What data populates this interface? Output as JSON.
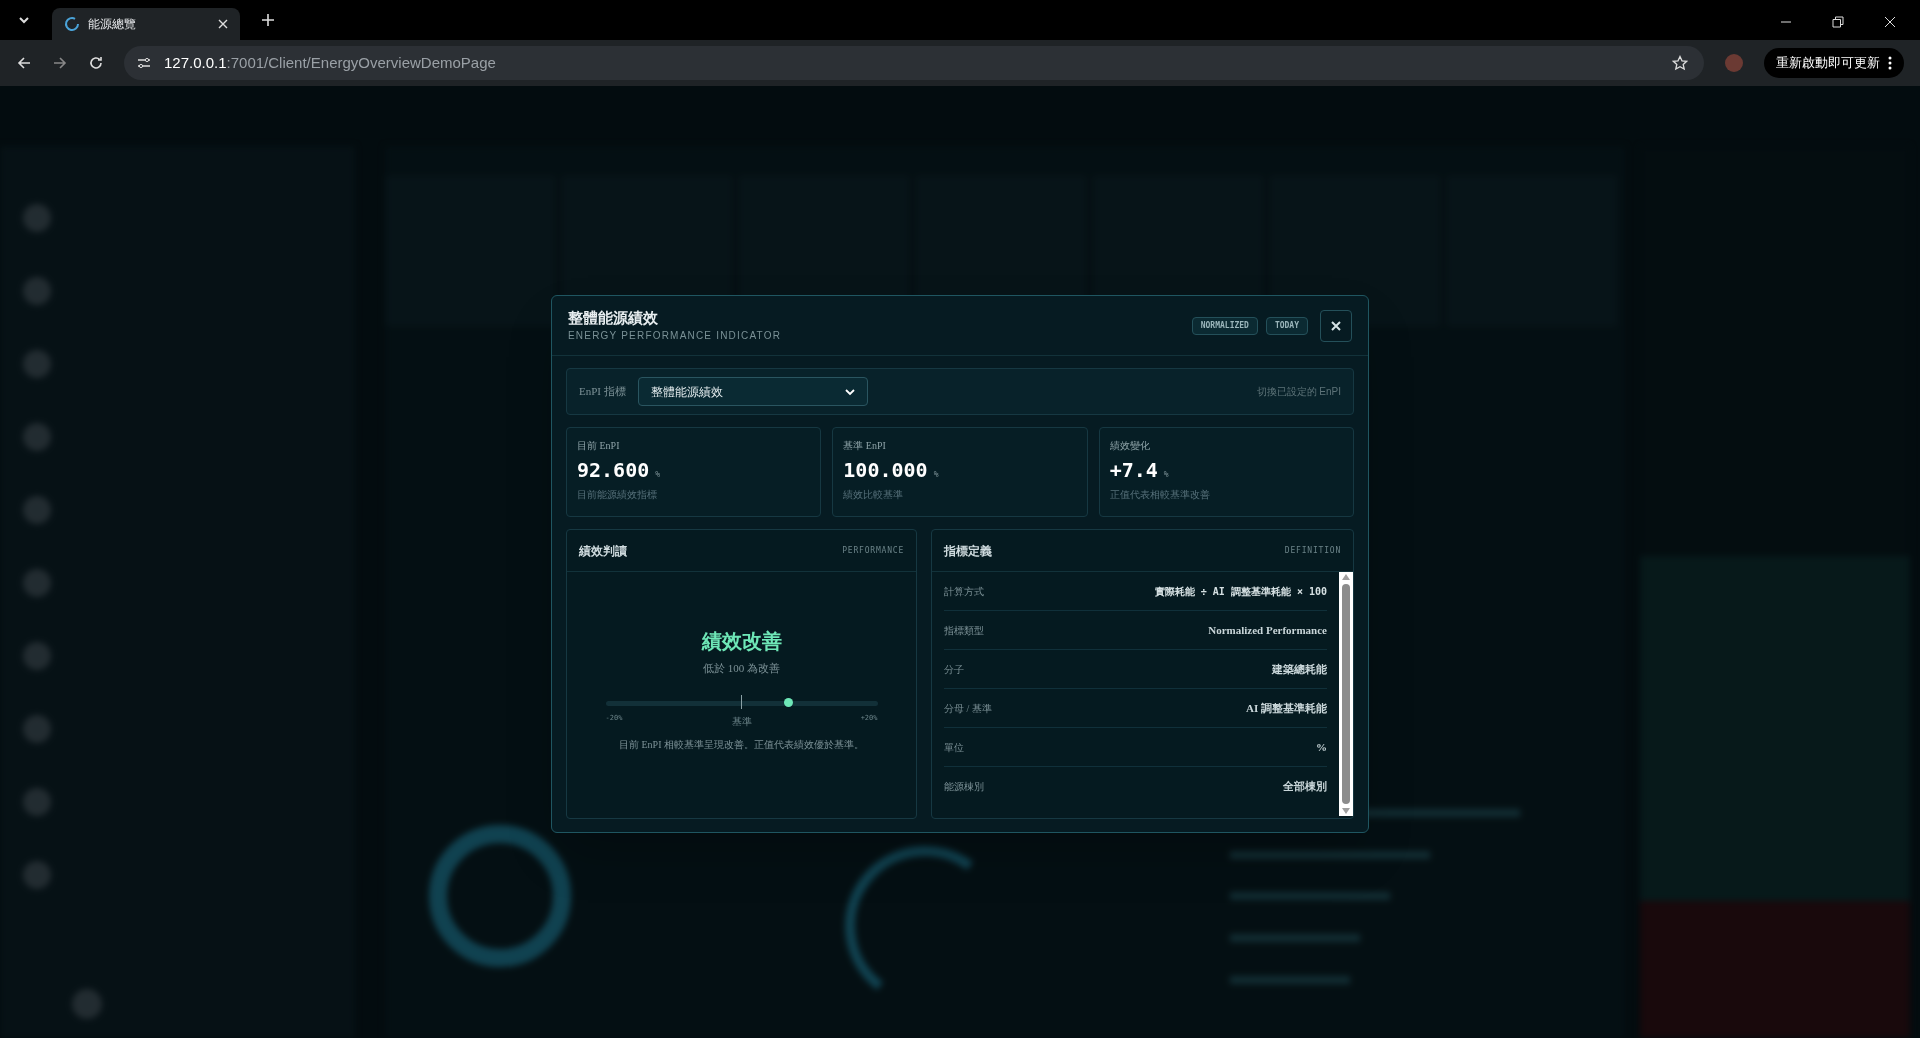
{
  "browser": {
    "tabs": [
      {
        "title": "能源總覽",
        "selected": true
      }
    ],
    "url": {
      "host": "127.0.0.1",
      "path": ":7001/Client/EnergyOverviewDemoPage"
    },
    "update_button": "重新啟動即可更新"
  },
  "modal": {
    "title": "整體能源績效",
    "subtitle": "ENERGY PERFORMANCE INDICATOR",
    "badges": [
      "NORMALIZED",
      "TODAY"
    ],
    "selector": {
      "label": "EnPI 指標",
      "value": "整體能源績效",
      "hint": "切換已設定的 EnPI"
    },
    "metrics": [
      {
        "label": "目前 EnPI",
        "value": "92.600",
        "unit": "%",
        "note": "目前能源績效指標"
      },
      {
        "label": "基準 EnPI",
        "value": "100.000",
        "unit": "%",
        "note": "績效比較基準"
      },
      {
        "label": "績效變化",
        "value": "+7.4",
        "unit": "%",
        "note": "正值代表相較基準改善"
      }
    ],
    "performance": {
      "title": "績效判讀",
      "tag": "PERFORMANCE",
      "status": "績效改善",
      "color": "#6ee7b7",
      "subtitle": "低於 100 為改善",
      "level": 0.67,
      "min_label": "-20%",
      "mid_label": "基準",
      "max_label": "+20%",
      "description": "目前 EnPI 相較基準呈現改善。正值代表績效優於基準。"
    },
    "definition": {
      "title": "指標定義",
      "tag": "DEFINITION",
      "rows": [
        {
          "label": "計算方式",
          "value": "實際耗能 ÷ AI 調整基準耗能 × 100",
          "kind": "formula"
        },
        {
          "label": "指標類型",
          "value": "Normalized Performance",
          "kind": "text"
        },
        {
          "label": "分子",
          "value": "建築總耗能",
          "kind": "text"
        },
        {
          "label": "分母 / 基準",
          "value": "AI 調整基準耗能",
          "kind": "text"
        },
        {
          "label": "單位",
          "value": "%",
          "kind": "text"
        },
        {
          "label": "能源棟別",
          "value": "全部棟別",
          "kind": "text"
        }
      ]
    }
  }
}
